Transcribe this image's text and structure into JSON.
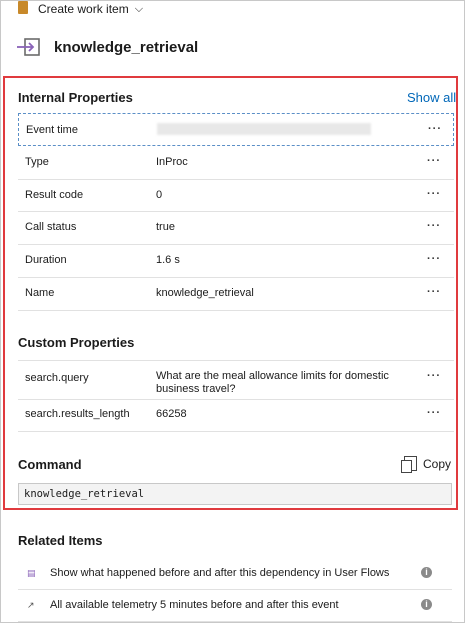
{
  "toolbar": {
    "create_work_item": "Create work item"
  },
  "title": "knowledge_retrieval",
  "internal": {
    "heading": "Internal Properties",
    "show_all": "Show all",
    "rows": [
      {
        "key": "Event time",
        "value": ""
      },
      {
        "key": "Type",
        "value": "InProc"
      },
      {
        "key": "Result code",
        "value": "0"
      },
      {
        "key": "Call status",
        "value": "true"
      },
      {
        "key": "Duration",
        "value": "1.6 s"
      },
      {
        "key": "Name",
        "value": "knowledge_retrieval"
      }
    ]
  },
  "custom": {
    "heading": "Custom Properties",
    "rows": [
      {
        "key": "search.query",
        "value": "What are the meal allowance limits for domestic business travel?"
      },
      {
        "key": "search.results_length",
        "value": "66258"
      }
    ]
  },
  "command": {
    "heading": "Command",
    "copy_label": "Copy",
    "text": "knowledge_retrieval"
  },
  "related": {
    "heading": "Related Items",
    "items": [
      {
        "label": "Show what happened before and after this dependency in User Flows"
      },
      {
        "label": "All available telemetry 5 minutes before and after this event"
      }
    ]
  },
  "more_label": "···",
  "info_label": "i",
  "colors": {
    "accent": "#0067b8",
    "highlight_border": "#e03a3e"
  }
}
